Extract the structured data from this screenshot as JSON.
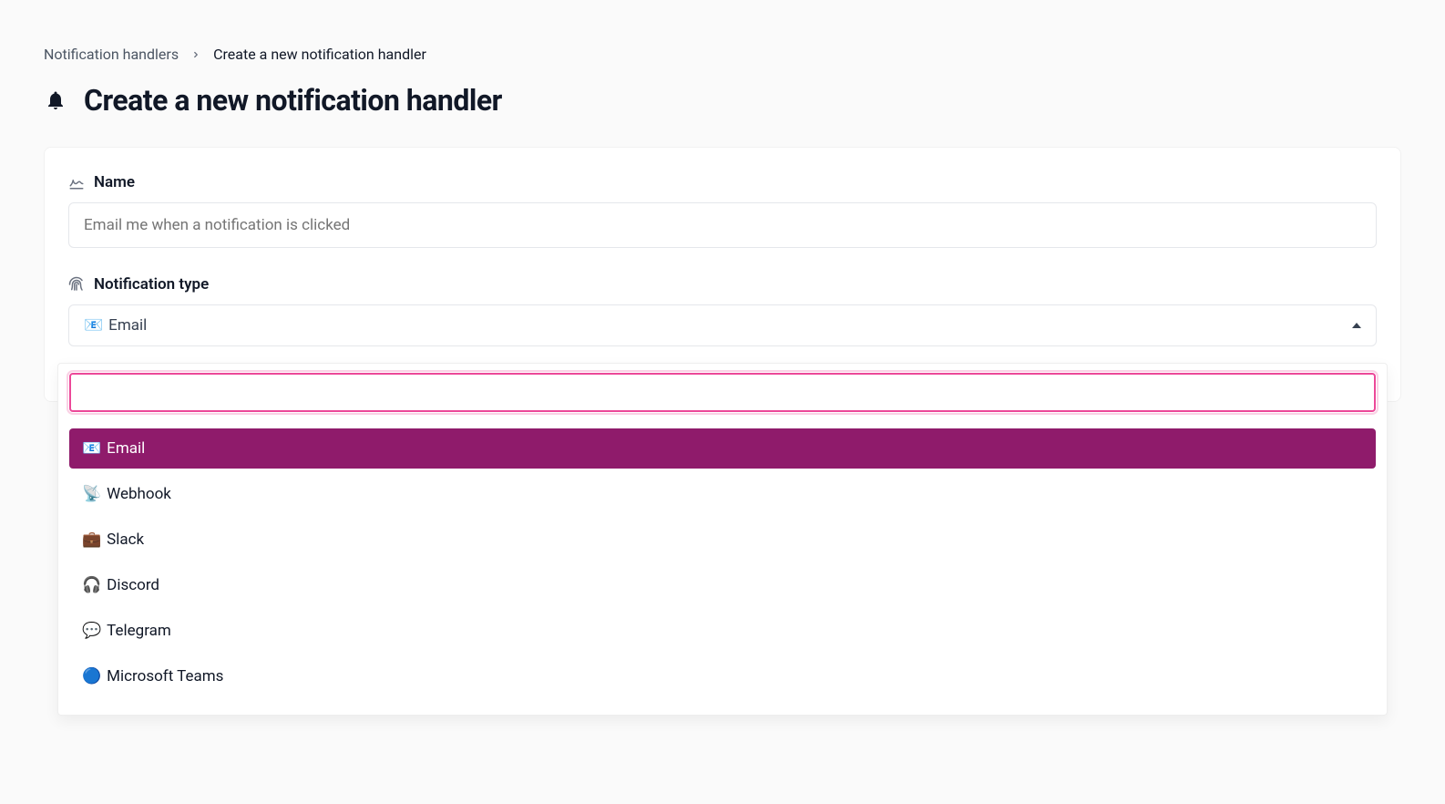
{
  "breadcrumb": {
    "root": "Notification handlers",
    "current": "Create a new notification handler"
  },
  "page_title": "Create a new notification handler",
  "form": {
    "name_label": "Name",
    "name_placeholder": "Email me when a notification is clicked",
    "type_label": "Notification type",
    "select": {
      "selected_emoji": "📧",
      "selected_label": "Email",
      "search_value": "",
      "options": [
        {
          "emoji": "📧",
          "label": "Email",
          "selected": true
        },
        {
          "emoji": "📡",
          "label": "Webhook",
          "selected": false
        },
        {
          "emoji": "💼",
          "label": "Slack",
          "selected": false
        },
        {
          "emoji": "🎧",
          "label": "Discord",
          "selected": false
        },
        {
          "emoji": "💬",
          "label": "Telegram",
          "selected": false
        },
        {
          "emoji": "🔵",
          "label": "Microsoft Teams",
          "selected": false
        }
      ]
    }
  }
}
